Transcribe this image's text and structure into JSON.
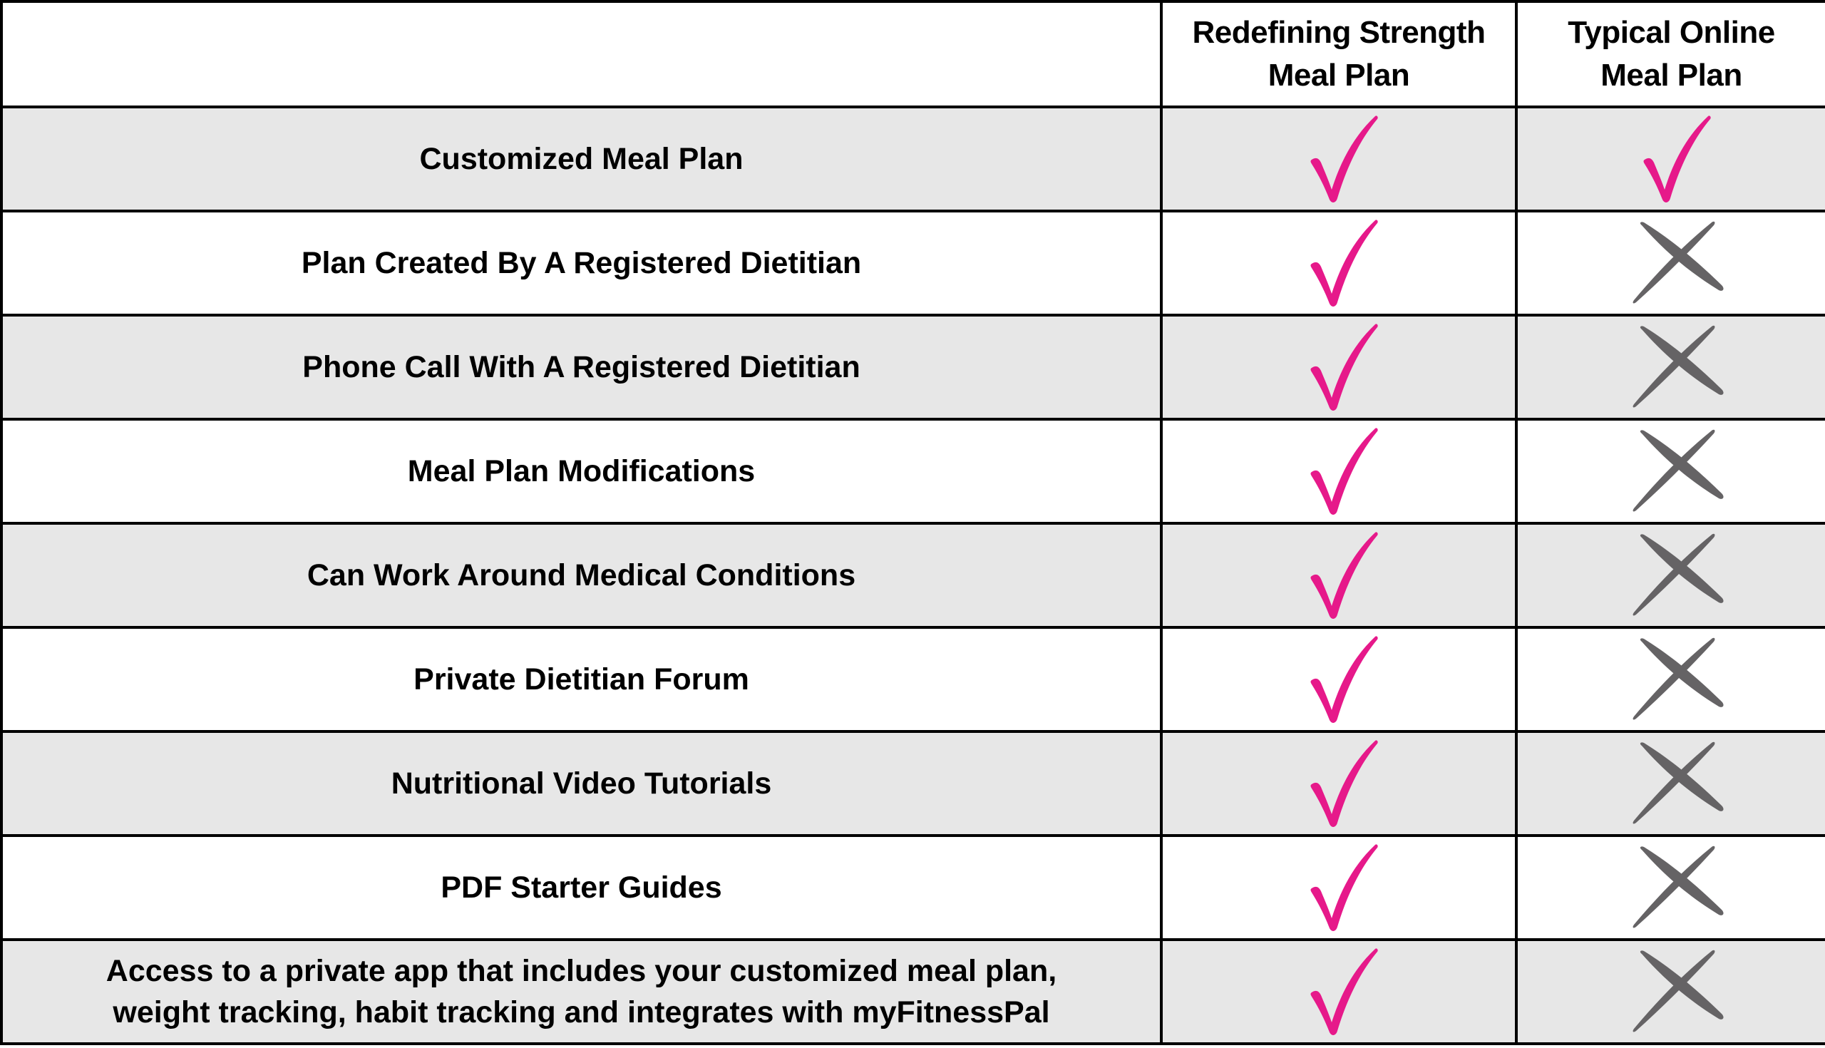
{
  "colors": {
    "check": "#e6198a",
    "cross": "#656365",
    "row_gray": "#e7e7e7",
    "border": "#000000"
  },
  "table": {
    "headers": {
      "feature": "",
      "redefining_strength_line1": "Redefining Strength",
      "redefining_strength_line2": "Meal Plan",
      "typical_online_line1": "Typical Online",
      "typical_online_line2": "Meal Plan"
    },
    "rows": [
      {
        "feature": "Customized Meal Plan",
        "redefining_strength": "check",
        "typical_online": "check"
      },
      {
        "feature": "Plan Created By A Registered Dietitian",
        "redefining_strength": "check",
        "typical_online": "cross"
      },
      {
        "feature": "Phone Call With A Registered Dietitian",
        "redefining_strength": "check",
        "typical_online": "cross"
      },
      {
        "feature": "Meal Plan Modifications",
        "redefining_strength": "check",
        "typical_online": "cross"
      },
      {
        "feature": "Can Work Around Medical Conditions",
        "redefining_strength": "check",
        "typical_online": "cross"
      },
      {
        "feature": "Private Dietitian Forum",
        "redefining_strength": "check",
        "typical_online": "cross"
      },
      {
        "feature": "Nutritional Video Tutorials",
        "redefining_strength": "check",
        "typical_online": "cross"
      },
      {
        "feature": "PDF Starter Guides",
        "redefining_strength": "check",
        "typical_online": "cross"
      },
      {
        "feature_line1": "Access to a private app that includes your customized meal plan,",
        "feature_line2": "weight tracking, habit tracking and integrates with myFitnessPal",
        "redefining_strength": "check",
        "typical_online": "cross"
      }
    ]
  }
}
